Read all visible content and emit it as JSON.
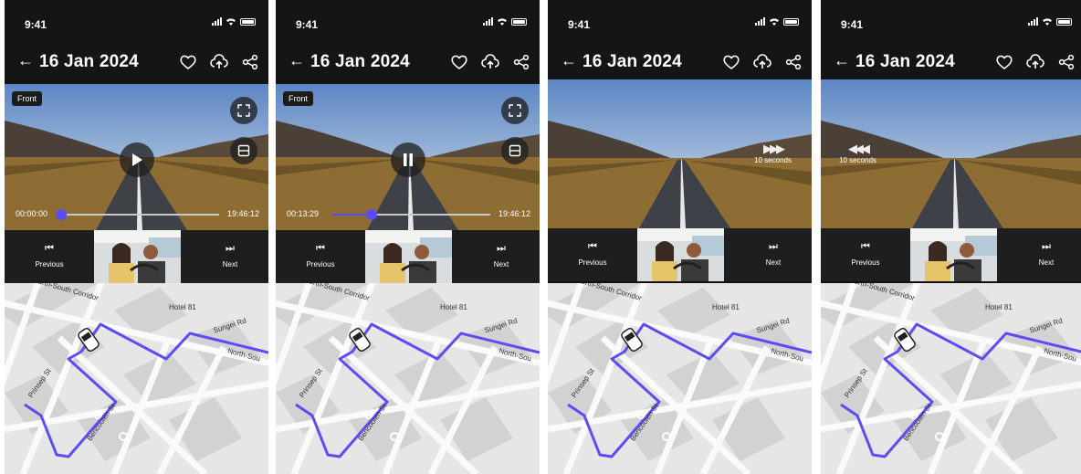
{
  "status": {
    "time": "9:41"
  },
  "header": {
    "title": "16 Jan 2024"
  },
  "video": {
    "camera_label": "Front",
    "screens": [
      {
        "elapsed": "00:00:00",
        "duration": "19:46:12",
        "progress": 0.0
      },
      {
        "elapsed": "00:13:29",
        "duration": "19:46:12",
        "progress": 0.25
      }
    ],
    "seek_label": "10 seconds"
  },
  "controls": {
    "previous": "Previous",
    "next": "Next"
  },
  "map": {
    "labels": {
      "corridor": "North-South Corridor",
      "hotel": "Hotel 81",
      "sungei": "Sungei Rd",
      "north": "North-Sou",
      "prinsep": "Prinsep St",
      "bencoolen": "Bencoolen St"
    }
  },
  "colors": {
    "accent": "#5b4cf5",
    "route": "#5b4cf5",
    "header_bg": "#151515"
  }
}
